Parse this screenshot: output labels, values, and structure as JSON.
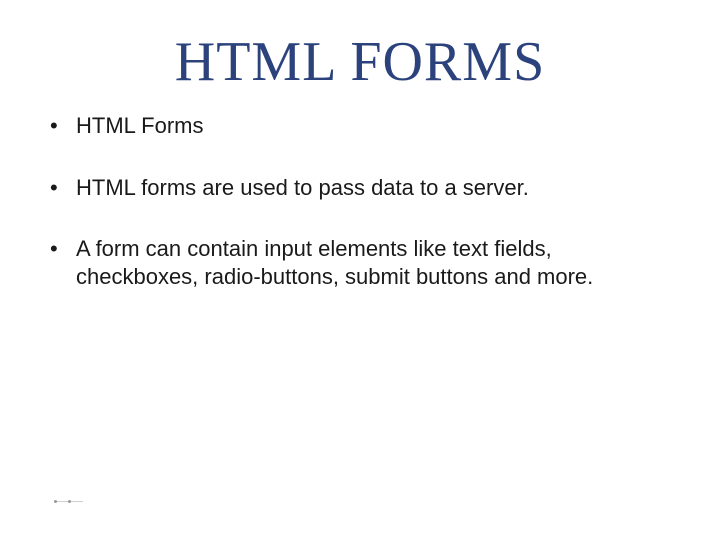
{
  "slide": {
    "title": "HTML FORMS",
    "bullets": [
      "HTML Forms",
      "HTML forms are used to pass data to a server.",
      "A form can contain input elements like text fields, checkboxes, radio-buttons, submit buttons and more."
    ]
  }
}
